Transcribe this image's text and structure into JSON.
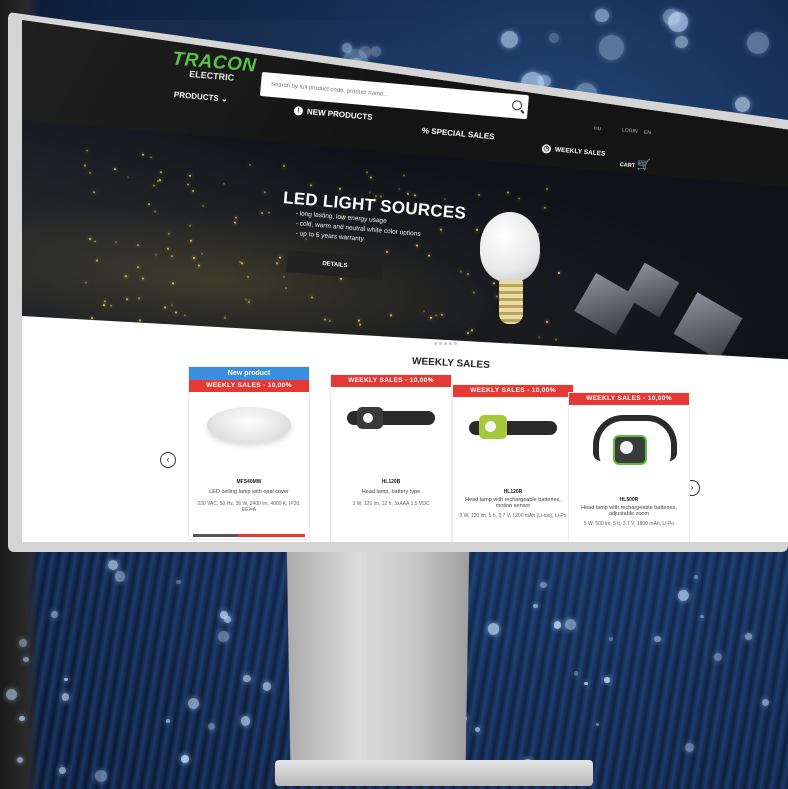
{
  "header": {
    "logo_top": "TRACON",
    "logo_bottom": "ELECTRIC",
    "search_placeholder": "Search by full product code, product name...",
    "nav": {
      "products": "PRODUCTS",
      "new_products": "NEW PRODUCTS",
      "special_sales": "SPECIAL SALES",
      "weekly_sales": "WEEKLY SALES",
      "cart": "CART"
    },
    "small_links": [
      "HU",
      "LOGIN",
      "EN"
    ]
  },
  "hero": {
    "title": "LED LIGHT SOURCES",
    "lines": [
      "- long lasting, low energy usage",
      "- cold, warm and neutral white color options",
      "- up to 5 years warranty"
    ],
    "button": "DETAILS"
  },
  "weekly": {
    "title": "WEEKLY SALES",
    "products": [
      {
        "new_badge": "New product",
        "sale": "WEEKLY SALES - 10,00%",
        "code": "MFS40MW",
        "name": "LED ceiling lamp with opal cover",
        "spec": "230 VAC, 50 Hz, 36 W, 2400 lm, 4000 K, IP20, EEI=A"
      },
      {
        "sale": "WEEKLY SALES - 10,00%",
        "code": "HL120B",
        "name": "Head lamp, battery type",
        "spec": "3 W, 120 lm, 12 h, 3xAAA 1,5 VDC"
      },
      {
        "sale": "WEEKLY SALES - 10,00%",
        "code": "HL120R",
        "name": "Head lamp with rechargeable batteries, motion sensor",
        "spec": "3 W, 120 lm, 5 h, 3,7 V, 1200 mAh (Li-ion), Li-Po"
      },
      {
        "sale": "WEEKLY SALES - 10,00%",
        "code": "HL500R",
        "name": "Head lamp with rechargeable batteries, adjustable zoom",
        "spec": "5 W, 500 lm, 5 h, 3,7 V, 1800 mAh, Li-Po"
      }
    ]
  },
  "colors": {
    "brand_green": "#53c142",
    "sale_red": "#e53935",
    "new_blue": "#3a8ee0"
  }
}
